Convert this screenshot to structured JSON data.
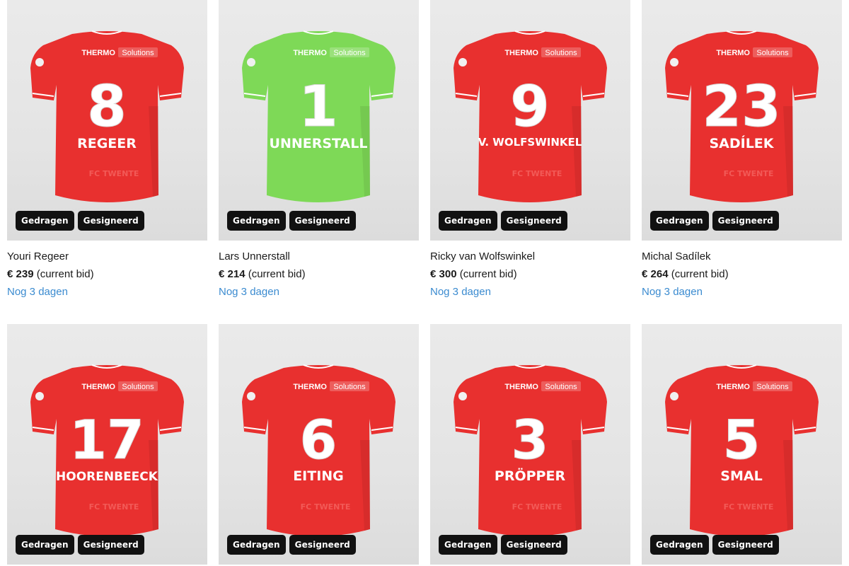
{
  "colors": {
    "home_shirt": "#e8302f",
    "keeper_shirt": "#7ed957",
    "badge_bg": "#111111",
    "time_text": "#3b8bd0"
  },
  "products": [
    {
      "number": "8",
      "shirt_name": "REGEER",
      "player": "Youri Regeer",
      "price": "€ 239",
      "bid_label": "(current bid)",
      "time_left": "Nog 3 dagen",
      "kit": "home",
      "badges": [
        "Gedragen",
        "Gesigneerd"
      ],
      "sponsor_a": "THERMO",
      "sponsor_b": "Solutions",
      "club": "FC TWENTE"
    },
    {
      "number": "1",
      "shirt_name": "UNNERSTALL",
      "player": "Lars Unnerstall",
      "price": "€ 214",
      "bid_label": "(current bid)",
      "time_left": "Nog 3 dagen",
      "kit": "keeper",
      "badges": [
        "Gedragen",
        "Gesigneerd"
      ],
      "sponsor_a": "THERMO",
      "sponsor_b": "Solutions",
      "club": ""
    },
    {
      "number": "9",
      "shirt_name": "V. WOLFSWINKEL",
      "player": "Ricky van Wolfswinkel",
      "price": "€ 300",
      "bid_label": "(current bid)",
      "time_left": "Nog 3 dagen",
      "kit": "home",
      "badges": [
        "Gedragen",
        "Gesigneerd"
      ],
      "sponsor_a": "THERMO",
      "sponsor_b": "Solutions",
      "club": "FC TWENTE"
    },
    {
      "number": "23",
      "shirt_name": "SADÍLEK",
      "player": "Michal Sadílek",
      "price": "€ 264",
      "bid_label": "(current bid)",
      "time_left": "Nog 3 dagen",
      "kit": "home",
      "badges": [
        "Gedragen",
        "Gesigneerd"
      ],
      "sponsor_a": "THERMO",
      "sponsor_b": "Solutions",
      "club": "FC TWENTE"
    },
    {
      "number": "17",
      "shirt_name": "HOORENBEECK",
      "player": "",
      "price": "",
      "bid_label": "",
      "time_left": "",
      "kit": "home",
      "badges": [
        "Gedragen",
        "Gesigneerd"
      ],
      "sponsor_a": "THERMO",
      "sponsor_b": "Solutions",
      "club": "FC TWENTE"
    },
    {
      "number": "6",
      "shirt_name": "EITING",
      "player": "",
      "price": "",
      "bid_label": "",
      "time_left": "",
      "kit": "home",
      "badges": [
        "Gedragen",
        "Gesigneerd"
      ],
      "sponsor_a": "THERMO",
      "sponsor_b": "Solutions",
      "club": "FC TWENTE"
    },
    {
      "number": "3",
      "shirt_name": "PRÖPPER",
      "player": "",
      "price": "",
      "bid_label": "",
      "time_left": "",
      "kit": "home",
      "badges": [
        "Gedragen",
        "Gesigneerd"
      ],
      "sponsor_a": "THERMO",
      "sponsor_b": "Solutions",
      "club": "FC TWENTE"
    },
    {
      "number": "5",
      "shirt_name": "SMAL",
      "player": "",
      "price": "",
      "bid_label": "",
      "time_left": "",
      "kit": "home",
      "badges": [
        "Gedragen",
        "Gesigneerd"
      ],
      "sponsor_a": "THERMO",
      "sponsor_b": "Solutions",
      "club": "FC TWENTE"
    }
  ]
}
